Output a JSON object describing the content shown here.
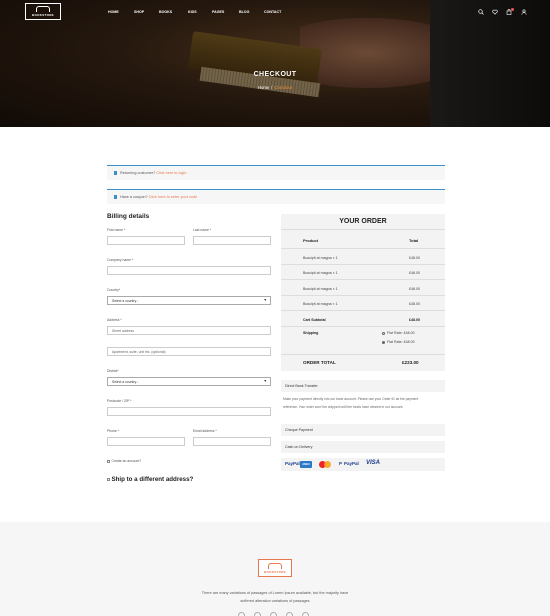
{
  "brand": {
    "logo_text": "BOOKSTORE",
    "accent": "#e8774f",
    "info_color": "#3a8fc7"
  },
  "nav": [
    "HOME",
    "SHOP",
    "BOOKS",
    "KIDS",
    "PAGES",
    "BLOG",
    "CONTACT"
  ],
  "header_icons": [
    "search-icon",
    "heart-icon",
    "cart-icon",
    "user-icon"
  ],
  "hero": {
    "title": "CHECKOUT",
    "breadcrumb": {
      "home": "Home",
      "sep": "/",
      "current": "Checkout"
    }
  },
  "notices": {
    "returning": {
      "text": "Returning customer?",
      "link": "Click here to login"
    },
    "coupon": {
      "text": "Have a coupon?",
      "link": "Click here to enter your code"
    }
  },
  "billing": {
    "title": "Billing details",
    "first_name": "First name *",
    "last_name": "Last name *",
    "company": "Company name *",
    "country": "Country*",
    "country_select": "Select a country...",
    "address": "Address *",
    "address_ph1": "Street address",
    "address_ph2": "Apartment, suite, unit etc. (optional)",
    "district": "District*",
    "district_select": "Select a country...",
    "postcode": "Postcode / ZIP *",
    "phone": "Phone *",
    "email": "Email address *",
    "create_account": "Create an account?",
    "ship_different": "Ship to a different address?"
  },
  "order": {
    "title": "YOUR ORDER",
    "col_product": "Product",
    "col_total": "Total",
    "items": [
      {
        "name": "Buscipit at magna × 1",
        "total": "£48.00"
      },
      {
        "name": "Buscipit at magna × 1",
        "total": "£48.00"
      },
      {
        "name": "Buscipit at magna × 1",
        "total": "£48.00"
      },
      {
        "name": "Buscipit at magna × 1",
        "total": "£48.00"
      }
    ],
    "subtotal_label": "Cart Subtotal",
    "subtotal": "£48.00",
    "shipping_label": "Shipping",
    "shipping_options": [
      "Flat Rate: £48.00",
      "Flat Rate: £48.00"
    ],
    "shipping_selected": 1,
    "total_label": "ORDER TOTAL",
    "total": "£223.00"
  },
  "payment": {
    "direct_bank": "Direct Bank Transfer",
    "direct_bank_desc": "Make your payment directly into our bank account. Please use your Order ID as the payment reference. Your order won't be shipped until the funds have cleared in our account.",
    "cheque": "Cheque Payment",
    "cod": "Cash on Delivery",
    "logos": {
      "paypal1": "PayPal",
      "amex": "AMEX",
      "paypal2": "PayPal",
      "visa": "VISA"
    }
  },
  "footer": {
    "line1": "There are many variations of passages of Lorem Ipsum available, but the majority have",
    "line2": "suffered alteration variations of passages"
  }
}
